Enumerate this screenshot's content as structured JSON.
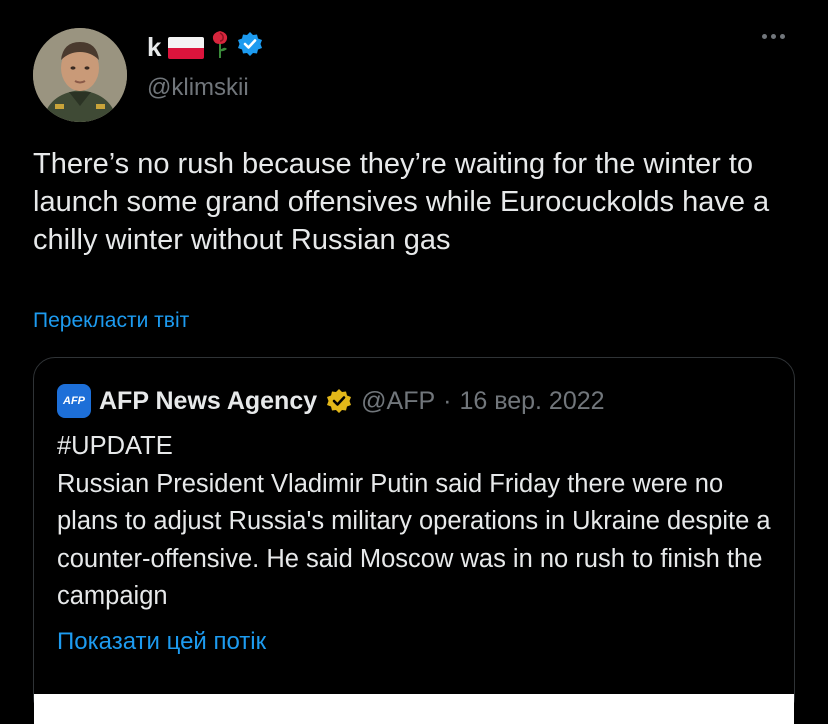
{
  "author": {
    "display_name": "k",
    "handle": "@klimskii",
    "avatar_icon": "military-portrait-avatar",
    "flag_icon": "poland-flag-icon",
    "rose_icon": "rose-icon",
    "verified_icon": "verified-badge-icon",
    "verified_color": "#1d9bf0"
  },
  "more_icon": "more-options-icon",
  "tweet": {
    "text": "There’s no rush because they’re waiting for the winter to launch some grand offensives while Eurocuckolds have a chilly winter without Russian gas",
    "translate_label": "Перекласти твіт"
  },
  "quote": {
    "logo_text": "AFP",
    "logo_color": "#1d6fd8",
    "author_name": "AFP News Agency",
    "verified_icon": "gold-verified-badge-icon",
    "verified_color": "#e2b719",
    "handle": "@AFP",
    "separator": "·",
    "date": "16 вер. 2022",
    "lines": [
      "#UPDATE",
      "Russian President Vladimir Putin said Friday there were no plans to adjust Russia's military operations in Ukraine despite a counter-offensive. He said Moscow was in no rush to finish the campaign"
    ],
    "show_thread_label": "Показати цей потік"
  },
  "colors": {
    "background": "#000000",
    "text": "#e7e9ea",
    "muted": "#71767b",
    "link": "#1d9bf0",
    "border": "#2f3336"
  }
}
